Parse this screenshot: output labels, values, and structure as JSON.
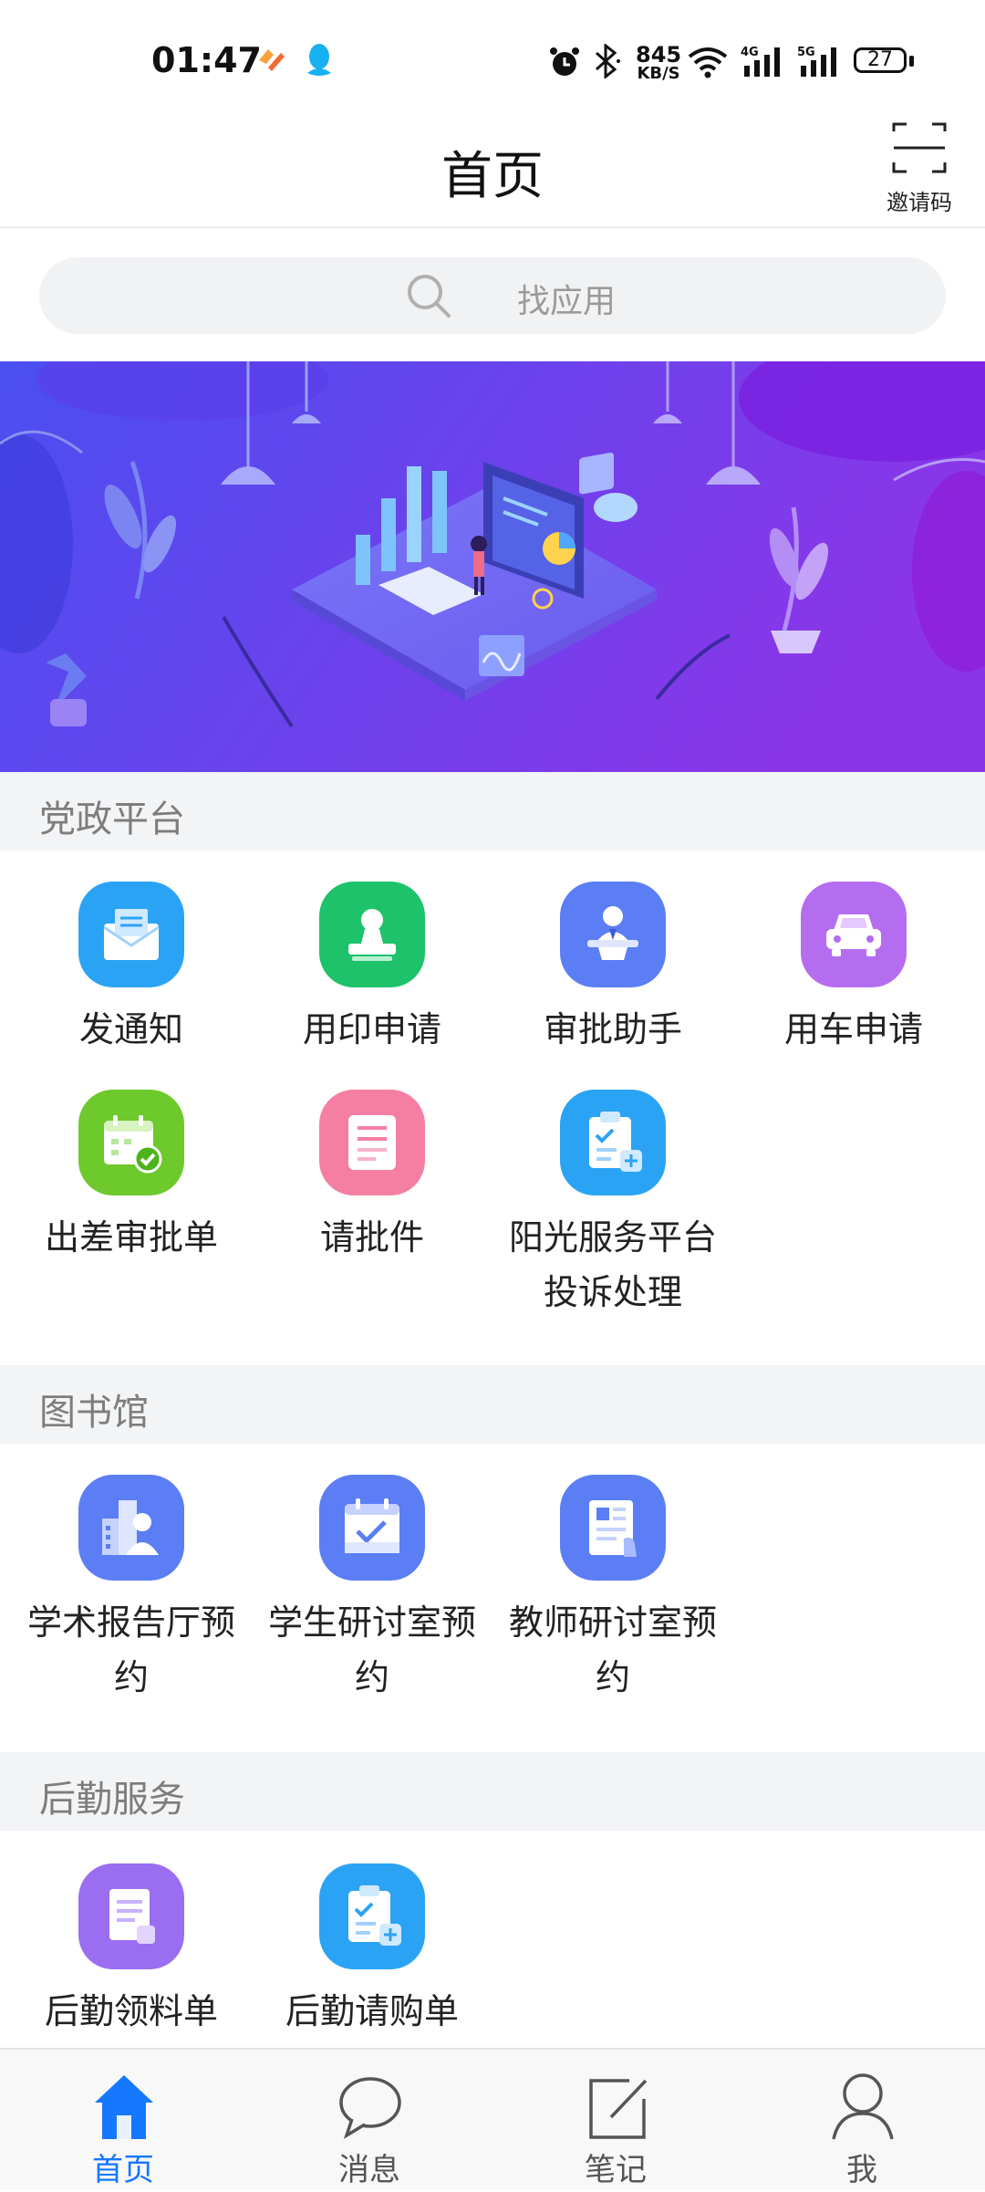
{
  "status_bar": {
    "time": "01:47",
    "net_speed_value": "845",
    "net_speed_unit": "KB/S",
    "signal_1": "4G",
    "signal_2": "5G",
    "battery": "27"
  },
  "header": {
    "title": "首页",
    "invite_label": "邀请码"
  },
  "search": {
    "placeholder": "找应用"
  },
  "sections": [
    {
      "title": "党政平台",
      "apps": [
        {
          "label": "发通知",
          "icon": "envelope-icon",
          "color": "#2ba3f5"
        },
        {
          "label": "用印申请",
          "icon": "stamp-icon",
          "color": "#1dc26a"
        },
        {
          "label": "审批助手",
          "icon": "assistant-icon",
          "color": "#5b7ef5"
        },
        {
          "label": "用车申请",
          "icon": "car-icon",
          "color": "#b56df0"
        },
        {
          "label": "出差审批单",
          "icon": "calendar-check-icon",
          "color": "#6dc92c"
        },
        {
          "label": "请批件",
          "icon": "document-icon",
          "color": "#f57fa2"
        },
        {
          "label": "阳光服务平台投诉处理",
          "icon": "clipboard-check-icon",
          "color": "#2ba3f5"
        }
      ]
    },
    {
      "title": "图书馆",
      "apps": [
        {
          "label": "学术报告厅预约",
          "icon": "lecture-hall-icon",
          "color": "#5b7ef5"
        },
        {
          "label": "学生研讨室预约",
          "icon": "calendar-check-icon",
          "color": "#5b7ef5"
        },
        {
          "label": "教师研讨室预约",
          "icon": "newspaper-icon",
          "color": "#5b7ef5"
        }
      ]
    },
    {
      "title": "后勤服务",
      "apps": [
        {
          "label": "后勤领料单",
          "icon": "scroll-icon",
          "color": "#9b6df0"
        },
        {
          "label": "后勤请购单",
          "icon": "clipboard-check-icon",
          "color": "#2ba3f5"
        }
      ]
    }
  ],
  "bottom_nav": [
    {
      "label": "首页",
      "icon": "home-icon",
      "active": true
    },
    {
      "label": "消息",
      "icon": "chat-icon",
      "active": false
    },
    {
      "label": "笔记",
      "icon": "edit-icon",
      "active": false
    },
    {
      "label": "我",
      "icon": "user-icon",
      "active": false
    }
  ],
  "colors": {
    "accent": "#1677ff",
    "banner_start": "#4a4ff0",
    "banner_end": "#8a36e8"
  }
}
